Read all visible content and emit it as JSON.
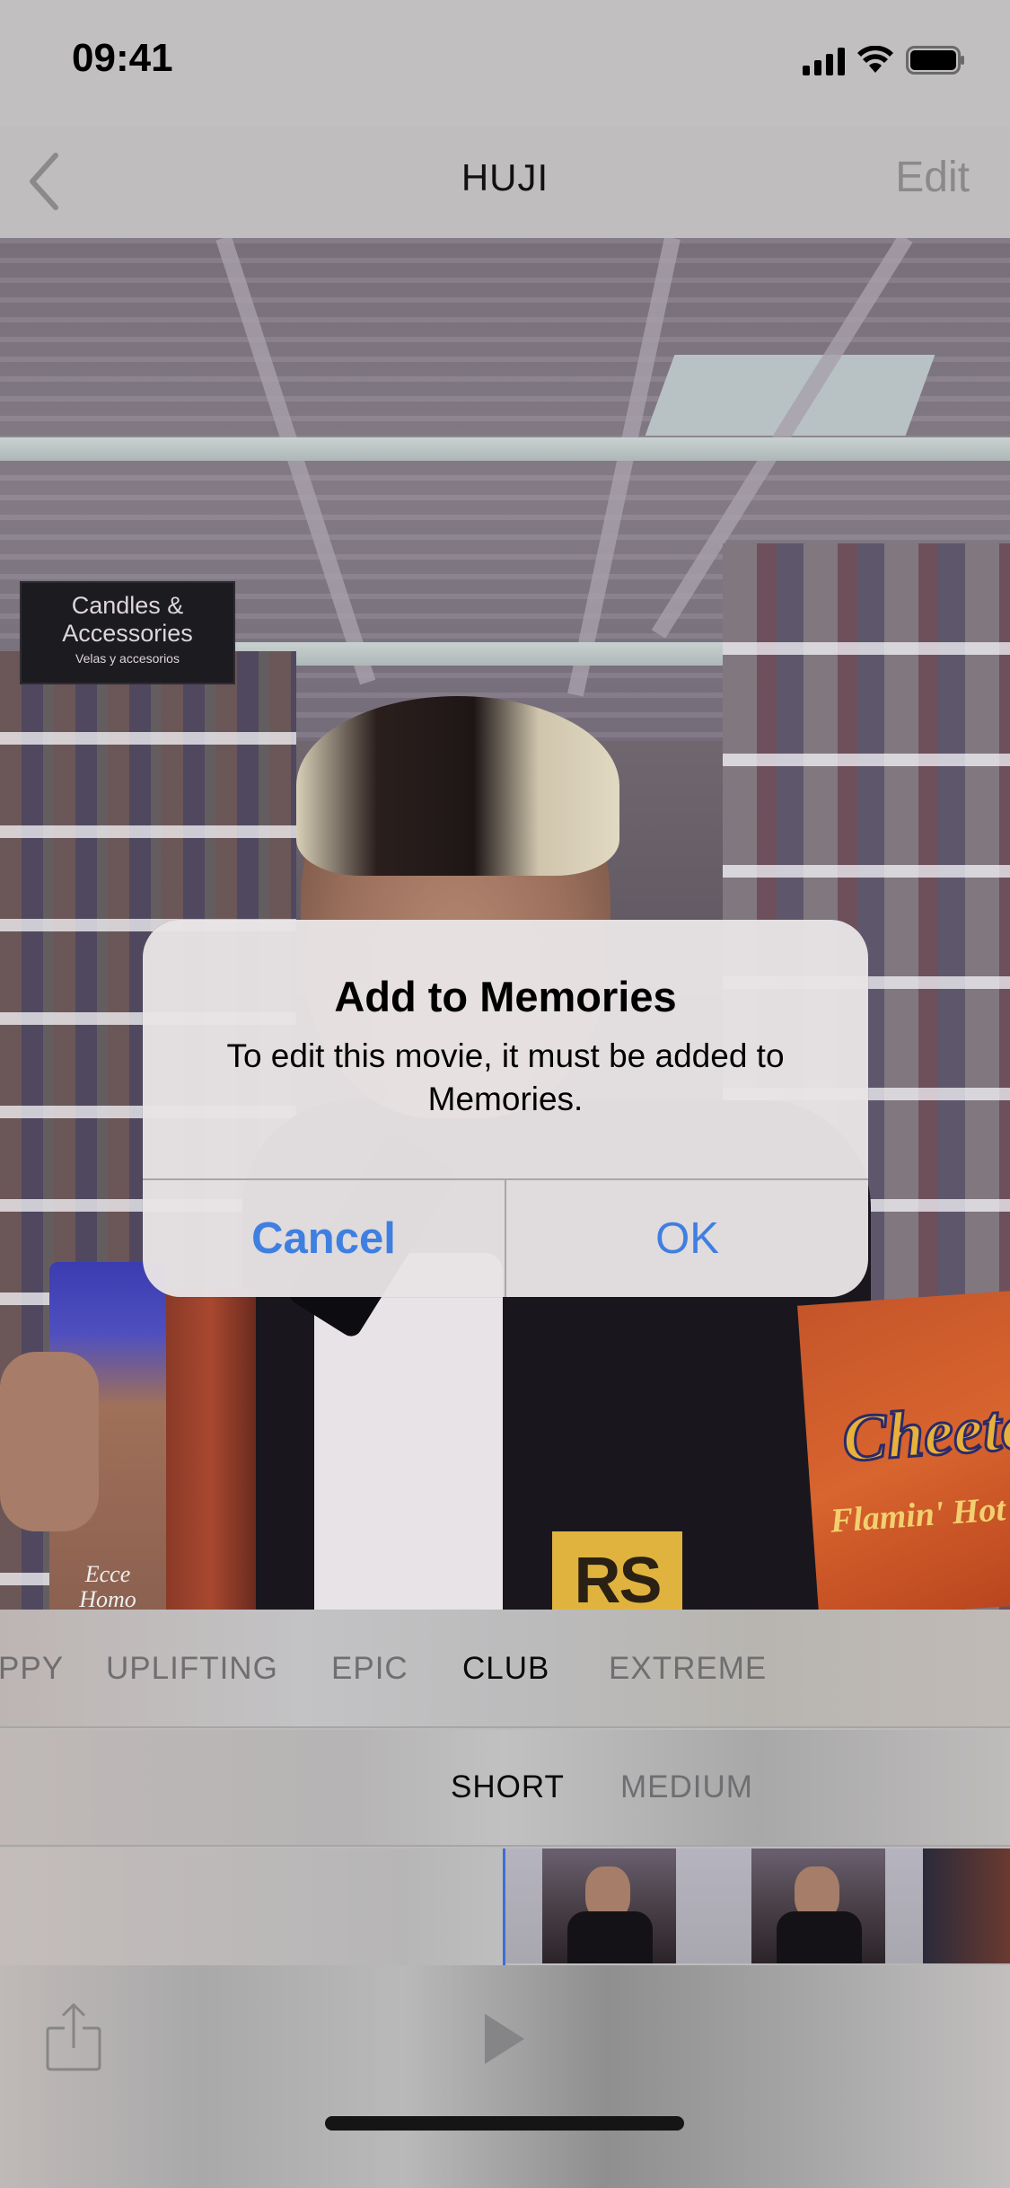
{
  "status_bar": {
    "time": "09:41",
    "icons": [
      "cellular-signal-icon",
      "wifi-icon",
      "battery-icon"
    ]
  },
  "nav": {
    "back_icon": "chevron-left-icon",
    "title": "HUJI",
    "edit_label": "Edit"
  },
  "photo": {
    "sign_line1": "Candles &",
    "sign_line2": "Accessories",
    "sign_sub": "Velas y accesorios",
    "candle_line1": "Ecce",
    "candle_line2": "Homo",
    "patch_text": "RS",
    "chips_logo": "Cheetos",
    "chips_sub": "Flamin' Hot"
  },
  "alert": {
    "title": "Add to Memories",
    "message": "To edit this movie, it must be added to Memories.",
    "cancel_label": "Cancel",
    "ok_label": "OK",
    "button_color": "#3f7fe0"
  },
  "themes": {
    "items": [
      {
        "label": "PPY",
        "active": false
      },
      {
        "label": "UPLIFTING",
        "active": false
      },
      {
        "label": "EPIC",
        "active": false
      },
      {
        "label": "CLUB",
        "active": true
      },
      {
        "label": "EXTREME",
        "active": false
      }
    ]
  },
  "durations": {
    "items": [
      {
        "label": "SHORT",
        "active": true
      },
      {
        "label": "MEDIUM",
        "active": false
      }
    ]
  },
  "toolbar": {
    "share_icon": "share-icon",
    "play_icon": "play-icon"
  }
}
